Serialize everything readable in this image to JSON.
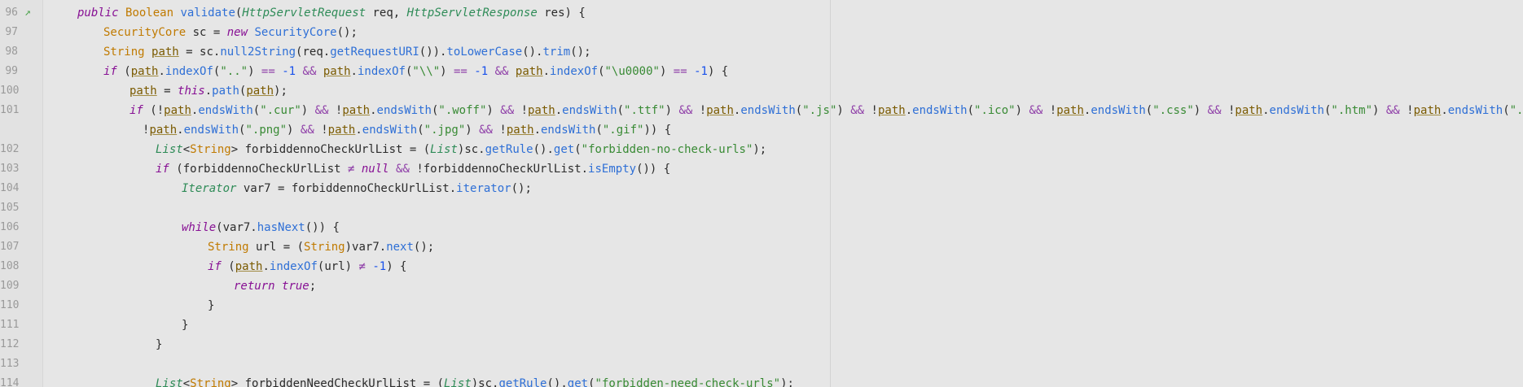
{
  "editor": {
    "lines": [
      {
        "no": "96",
        "marker": "override-icon",
        "indent": 1,
        "tokens": [
          {
            "t": "public ",
            "c": "kw2"
          },
          {
            "t": "Boolean ",
            "c": "tp"
          },
          {
            "t": "validate",
            "c": "fn"
          },
          {
            "t": "(",
            "c": "pl"
          },
          {
            "t": "HttpServletRequest",
            "c": "tpi"
          },
          {
            "t": " req, ",
            "c": "pl"
          },
          {
            "t": "HttpServletResponse",
            "c": "tpi"
          },
          {
            "t": " res) {",
            "c": "pl"
          }
        ]
      },
      {
        "no": "97",
        "indent": 2,
        "tokens": [
          {
            "t": "SecurityCore ",
            "c": "tp"
          },
          {
            "t": "sc = ",
            "c": "pl"
          },
          {
            "t": "new ",
            "c": "kw2"
          },
          {
            "t": "SecurityCore",
            "c": "fn"
          },
          {
            "t": "();",
            "c": "pl"
          }
        ]
      },
      {
        "no": "98",
        "indent": 2,
        "tokens": [
          {
            "t": "String ",
            "c": "tp"
          },
          {
            "t": "path",
            "c": "var"
          },
          {
            "t": " = sc.",
            "c": "pl"
          },
          {
            "t": "null2String",
            "c": "fn"
          },
          {
            "t": "(req.",
            "c": "pl"
          },
          {
            "t": "getRequestURI",
            "c": "fn"
          },
          {
            "t": "()).",
            "c": "pl"
          },
          {
            "t": "toLowerCase",
            "c": "fn"
          },
          {
            "t": "().",
            "c": "pl"
          },
          {
            "t": "trim",
            "c": "fn"
          },
          {
            "t": "();",
            "c": "pl"
          }
        ]
      },
      {
        "no": "99",
        "indent": 2,
        "tokens": [
          {
            "t": "if ",
            "c": "kw2"
          },
          {
            "t": "(",
            "c": "pl"
          },
          {
            "t": "path",
            "c": "var"
          },
          {
            "t": ".",
            "c": "pl"
          },
          {
            "t": "indexOf",
            "c": "fn"
          },
          {
            "t": "(",
            "c": "pl"
          },
          {
            "t": "\"..\"",
            "c": "str"
          },
          {
            "t": ") ",
            "c": "pl"
          },
          {
            "t": "== ",
            "c": "op"
          },
          {
            "t": "-1 ",
            "c": "num"
          },
          {
            "t": "&& ",
            "c": "op"
          },
          {
            "t": "path",
            "c": "var"
          },
          {
            "t": ".",
            "c": "pl"
          },
          {
            "t": "indexOf",
            "c": "fn"
          },
          {
            "t": "(",
            "c": "pl"
          },
          {
            "t": "\"\\\\\"",
            "c": "str"
          },
          {
            "t": ") ",
            "c": "pl"
          },
          {
            "t": "== ",
            "c": "op"
          },
          {
            "t": "-1 ",
            "c": "num"
          },
          {
            "t": "&& ",
            "c": "op"
          },
          {
            "t": "path",
            "c": "var"
          },
          {
            "t": ".",
            "c": "pl"
          },
          {
            "t": "indexOf",
            "c": "fn"
          },
          {
            "t": "(",
            "c": "pl"
          },
          {
            "t": "\"\\u0000\"",
            "c": "str"
          },
          {
            "t": ") ",
            "c": "pl"
          },
          {
            "t": "== ",
            "c": "op"
          },
          {
            "t": "-1",
            "c": "num"
          },
          {
            "t": ") {",
            "c": "pl"
          }
        ]
      },
      {
        "no": "100",
        "indent": 3,
        "tokens": [
          {
            "t": "path",
            "c": "var"
          },
          {
            "t": " = ",
            "c": "pl"
          },
          {
            "t": "this",
            "c": "kw2"
          },
          {
            "t": ".",
            "c": "pl"
          },
          {
            "t": "path",
            "c": "fn"
          },
          {
            "t": "(",
            "c": "pl"
          },
          {
            "t": "path",
            "c": "var"
          },
          {
            "t": ");",
            "c": "pl"
          }
        ]
      },
      {
        "no": "101",
        "indent": 3,
        "tokens": [
          {
            "t": "if ",
            "c": "kw2"
          },
          {
            "t": "(!",
            "c": "pl"
          },
          {
            "t": "path",
            "c": "var"
          },
          {
            "t": ".",
            "c": "pl"
          },
          {
            "t": "endsWith",
            "c": "fn"
          },
          {
            "t": "(",
            "c": "pl"
          },
          {
            "t": "\".cur\"",
            "c": "str"
          },
          {
            "t": ") ",
            "c": "pl"
          },
          {
            "t": "&& ",
            "c": "op"
          },
          {
            "t": "!",
            "c": "pl"
          },
          {
            "t": "path",
            "c": "var"
          },
          {
            "t": ".",
            "c": "pl"
          },
          {
            "t": "endsWith",
            "c": "fn"
          },
          {
            "t": "(",
            "c": "pl"
          },
          {
            "t": "\".woff\"",
            "c": "str"
          },
          {
            "t": ") ",
            "c": "pl"
          },
          {
            "t": "&& ",
            "c": "op"
          },
          {
            "t": "!",
            "c": "pl"
          },
          {
            "t": "path",
            "c": "var"
          },
          {
            "t": ".",
            "c": "pl"
          },
          {
            "t": "endsWith",
            "c": "fn"
          },
          {
            "t": "(",
            "c": "pl"
          },
          {
            "t": "\".ttf\"",
            "c": "str"
          },
          {
            "t": ") ",
            "c": "pl"
          },
          {
            "t": "&& ",
            "c": "op"
          },
          {
            "t": "!",
            "c": "pl"
          },
          {
            "t": "path",
            "c": "var"
          },
          {
            "t": ".",
            "c": "pl"
          },
          {
            "t": "endsWith",
            "c": "fn"
          },
          {
            "t": "(",
            "c": "pl"
          },
          {
            "t": "\".js\"",
            "c": "str"
          },
          {
            "t": ") ",
            "c": "pl"
          },
          {
            "t": "&& ",
            "c": "op"
          },
          {
            "t": "!",
            "c": "pl"
          },
          {
            "t": "path",
            "c": "var"
          },
          {
            "t": ".",
            "c": "pl"
          },
          {
            "t": "endsWith",
            "c": "fn"
          },
          {
            "t": "(",
            "c": "pl"
          },
          {
            "t": "\".ico\"",
            "c": "str"
          },
          {
            "t": ") ",
            "c": "pl"
          },
          {
            "t": "&& ",
            "c": "op"
          },
          {
            "t": "!",
            "c": "pl"
          },
          {
            "t": "path",
            "c": "var"
          },
          {
            "t": ".",
            "c": "pl"
          },
          {
            "t": "endsWith",
            "c": "fn"
          },
          {
            "t": "(",
            "c": "pl"
          },
          {
            "t": "\".css\"",
            "c": "str"
          },
          {
            "t": ") ",
            "c": "pl"
          },
          {
            "t": "&& ",
            "c": "op"
          },
          {
            "t": "!",
            "c": "pl"
          },
          {
            "t": "path",
            "c": "var"
          },
          {
            "t": ".",
            "c": "pl"
          },
          {
            "t": "endsWith",
            "c": "fn"
          },
          {
            "t": "(",
            "c": "pl"
          },
          {
            "t": "\".htm\"",
            "c": "str"
          },
          {
            "t": ") ",
            "c": "pl"
          },
          {
            "t": "&& ",
            "c": "op"
          },
          {
            "t": "!",
            "c": "pl"
          },
          {
            "t": "path",
            "c": "var"
          },
          {
            "t": ".",
            "c": "pl"
          },
          {
            "t": "endsWith",
            "c": "fn"
          },
          {
            "t": "(",
            "c": "pl"
          },
          {
            "t": "\".html\"",
            "c": "str"
          },
          {
            "t": ") ",
            "c": "pl"
          },
          {
            "t": "&&",
            "c": "op"
          }
        ]
      },
      {
        "no": "",
        "indent": 3,
        "extra": 1,
        "tokens": [
          {
            "t": "!",
            "c": "pl"
          },
          {
            "t": "path",
            "c": "var"
          },
          {
            "t": ".",
            "c": "pl"
          },
          {
            "t": "endsWith",
            "c": "fn"
          },
          {
            "t": "(",
            "c": "pl"
          },
          {
            "t": "\".png\"",
            "c": "str"
          },
          {
            "t": ") ",
            "c": "pl"
          },
          {
            "t": "&& ",
            "c": "op"
          },
          {
            "t": "!",
            "c": "pl"
          },
          {
            "t": "path",
            "c": "var"
          },
          {
            "t": ".",
            "c": "pl"
          },
          {
            "t": "endsWith",
            "c": "fn"
          },
          {
            "t": "(",
            "c": "pl"
          },
          {
            "t": "\".jpg\"",
            "c": "str"
          },
          {
            "t": ") ",
            "c": "pl"
          },
          {
            "t": "&& ",
            "c": "op"
          },
          {
            "t": "!",
            "c": "pl"
          },
          {
            "t": "path",
            "c": "var"
          },
          {
            "t": ".",
            "c": "pl"
          },
          {
            "t": "endsWith",
            "c": "fn"
          },
          {
            "t": "(",
            "c": "pl"
          },
          {
            "t": "\".gif\"",
            "c": "str"
          },
          {
            "t": ")) {",
            "c": "pl"
          }
        ]
      },
      {
        "no": "102",
        "indent": 4,
        "tokens": [
          {
            "t": "List",
            "c": "tpi"
          },
          {
            "t": "<",
            "c": "pl"
          },
          {
            "t": "String",
            "c": "tp"
          },
          {
            "t": "> ",
            "c": "pl"
          },
          {
            "t": "forbiddennoCheckUrlList = (",
            "c": "pl"
          },
          {
            "t": "List",
            "c": "tpi"
          },
          {
            "t": ")sc.",
            "c": "pl"
          },
          {
            "t": "getRule",
            "c": "fn"
          },
          {
            "t": "().",
            "c": "pl"
          },
          {
            "t": "get",
            "c": "fn"
          },
          {
            "t": "(",
            "c": "pl"
          },
          {
            "t": "\"forbidden-no-check-urls\"",
            "c": "str"
          },
          {
            "t": ");",
            "c": "pl"
          }
        ]
      },
      {
        "no": "103",
        "indent": 4,
        "tokens": [
          {
            "t": "if ",
            "c": "kw2"
          },
          {
            "t": "(forbiddennoCheckUrlList ",
            "c": "pl"
          },
          {
            "t": "≠ ",
            "c": "op"
          },
          {
            "t": "null ",
            "c": "kw2"
          },
          {
            "t": "&& ",
            "c": "op"
          },
          {
            "t": "!forbiddennoCheckUrlList.",
            "c": "pl"
          },
          {
            "t": "isEmpty",
            "c": "fn"
          },
          {
            "t": "()) {",
            "c": "pl"
          }
        ]
      },
      {
        "no": "104",
        "indent": 5,
        "tokens": [
          {
            "t": "Iterator ",
            "c": "tpi"
          },
          {
            "t": "var7 = forbiddennoCheckUrlList.",
            "c": "pl"
          },
          {
            "t": "iterator",
            "c": "fn"
          },
          {
            "t": "();",
            "c": "pl"
          }
        ]
      },
      {
        "no": "105",
        "indent": 0,
        "tokens": []
      },
      {
        "no": "106",
        "indent": 5,
        "tokens": [
          {
            "t": "while",
            "c": "kw2"
          },
          {
            "t": "(var7.",
            "c": "pl"
          },
          {
            "t": "hasNext",
            "c": "fn"
          },
          {
            "t": "()) {",
            "c": "pl"
          }
        ]
      },
      {
        "no": "107",
        "indent": 6,
        "tokens": [
          {
            "t": "String ",
            "c": "tp"
          },
          {
            "t": "url = (",
            "c": "pl"
          },
          {
            "t": "String",
            "c": "tp"
          },
          {
            "t": ")var7.",
            "c": "pl"
          },
          {
            "t": "next",
            "c": "fn"
          },
          {
            "t": "();",
            "c": "pl"
          }
        ]
      },
      {
        "no": "108",
        "indent": 6,
        "tokens": [
          {
            "t": "if ",
            "c": "kw2"
          },
          {
            "t": "(",
            "c": "pl"
          },
          {
            "t": "path",
            "c": "var"
          },
          {
            "t": ".",
            "c": "pl"
          },
          {
            "t": "indexOf",
            "c": "fn"
          },
          {
            "t": "(url) ",
            "c": "pl"
          },
          {
            "t": "≠ ",
            "c": "op"
          },
          {
            "t": "-1",
            "c": "num"
          },
          {
            "t": ") {",
            "c": "pl"
          }
        ]
      },
      {
        "no": "109",
        "indent": 7,
        "tokens": [
          {
            "t": "return ",
            "c": "kw2"
          },
          {
            "t": "true",
            "c": "kw2"
          },
          {
            "t": ";",
            "c": "pl"
          }
        ]
      },
      {
        "no": "110",
        "indent": 6,
        "tokens": [
          {
            "t": "}",
            "c": "pl"
          }
        ]
      },
      {
        "no": "111",
        "indent": 5,
        "tokens": [
          {
            "t": "}",
            "c": "pl"
          }
        ]
      },
      {
        "no": "112",
        "indent": 4,
        "tokens": [
          {
            "t": "}",
            "c": "pl"
          }
        ]
      },
      {
        "no": "113",
        "indent": 0,
        "tokens": []
      },
      {
        "no": "114",
        "indent": 4,
        "tokens": [
          {
            "t": "List",
            "c": "tpi"
          },
          {
            "t": "<",
            "c": "pl"
          },
          {
            "t": "String",
            "c": "tp"
          },
          {
            "t": "> ",
            "c": "pl"
          },
          {
            "t": "forbiddenNeedCheckUrlList = (",
            "c": "pl"
          },
          {
            "t": "List",
            "c": "tpi"
          },
          {
            "t": ")sc.",
            "c": "pl"
          },
          {
            "t": "getRule",
            "c": "fn"
          },
          {
            "t": "().",
            "c": "pl"
          },
          {
            "t": "get",
            "c": "fn"
          },
          {
            "t": "(",
            "c": "pl"
          },
          {
            "t": "\"forbidden-need-check-urls\"",
            "c": "str"
          },
          {
            "t": ");",
            "c": "pl"
          }
        ]
      }
    ]
  }
}
